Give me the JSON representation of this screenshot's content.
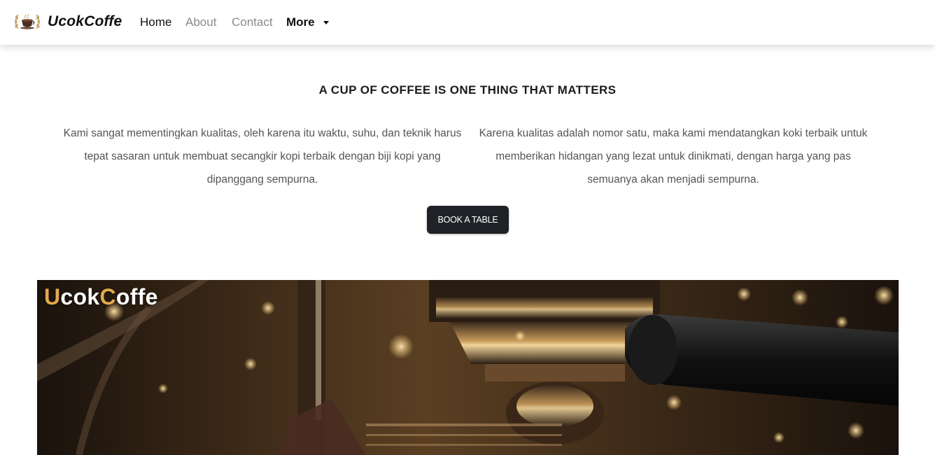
{
  "brand": {
    "name": "UcokCoffe",
    "logo_icon": "coffee-cup-laurel-icon"
  },
  "nav": {
    "home": "Home",
    "about": "About",
    "contact": "Contact",
    "more": "More"
  },
  "hero": {
    "headline": "A CUP OF COFFEE IS ONE THING THAT MATTERS",
    "paragraph_left": "Kami sangat mementingkan kualitas, oleh karena itu waktu, suhu, dan teknik harus tepat sasaran untuk membuat secangkir kopi terbaik dengan biji kopi yang dipanggang sempurna.",
    "paragraph_right": "Karena kualitas adalah nomor satu, maka kami mendatangkan koki terbaik untuk memberikan hidangan yang lezat untuk dinikmati, dengan harga yang pas semuanya akan menjadi sempurna.",
    "book_button": "BOOK A TABLE"
  },
  "photo": {
    "brand_part1": "U",
    "brand_part2": "cok",
    "brand_part3": "C",
    "brand_part4": "offe",
    "subject": "espresso-machine-photo"
  },
  "colors": {
    "accent": "#e3a94b",
    "button_bg": "#1f2327",
    "nav_active": "#111111",
    "nav_muted": "#8a8a8a"
  }
}
